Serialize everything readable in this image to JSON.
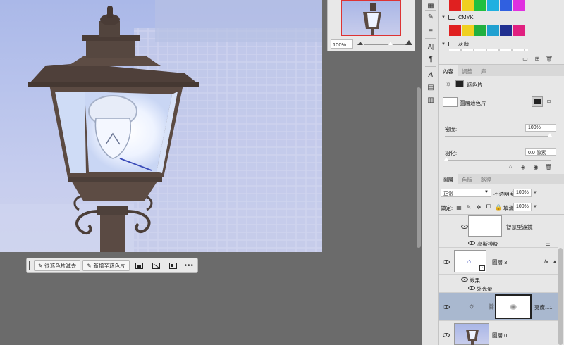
{
  "taskbar": {
    "subtract_label": "從遮色片減去",
    "add_label": "新增至遮色片"
  },
  "navigator": {
    "zoom": "100%"
  },
  "swatches": {
    "top_colors": [
      "#e02020",
      "#f0d020",
      "#20c040",
      "#20b0e0",
      "#3060e0",
      "#e030e0"
    ],
    "cmyk_group": "CMYK",
    "cmyk_colors": [
      "#e02020",
      "#f0d020",
      "#20b040",
      "#20a0d0",
      "#203090",
      "#e02080"
    ],
    "gray_group": "灰階"
  },
  "properties": {
    "tabs": [
      "內容",
      "調整",
      "庫"
    ],
    "mask_kind": "遮色片",
    "layer_mask_label": "圖層遮色片",
    "density_label": "密度:",
    "density_value": "100%",
    "feather_label": "羽化:",
    "feather_value": "0.0 像素"
  },
  "layers_panel": {
    "tabs": [
      "圖層",
      "色版",
      "路徑"
    ],
    "blend_mode": "正常",
    "opacity_label": "不透明度:",
    "opacity_value": "100%",
    "lock_label": "鎖定:",
    "fill_label": "填滿:",
    "fill_value": "100%",
    "smart_filters_label": "智慧型濾鏡",
    "gaussian_blur_label": "高斯模糊",
    "layer3_name": "圖層 3",
    "fx": "fx",
    "effects_label": "效果",
    "outer_glow_label": "外光暈",
    "adjustment_name": "亮度...1",
    "layer0_name": "圖層 0"
  },
  "colors": {
    "panel_bg": "#e7e7e7",
    "selected_row": "#a9b8cf",
    "canvas_bg": "#6b6b6b"
  }
}
